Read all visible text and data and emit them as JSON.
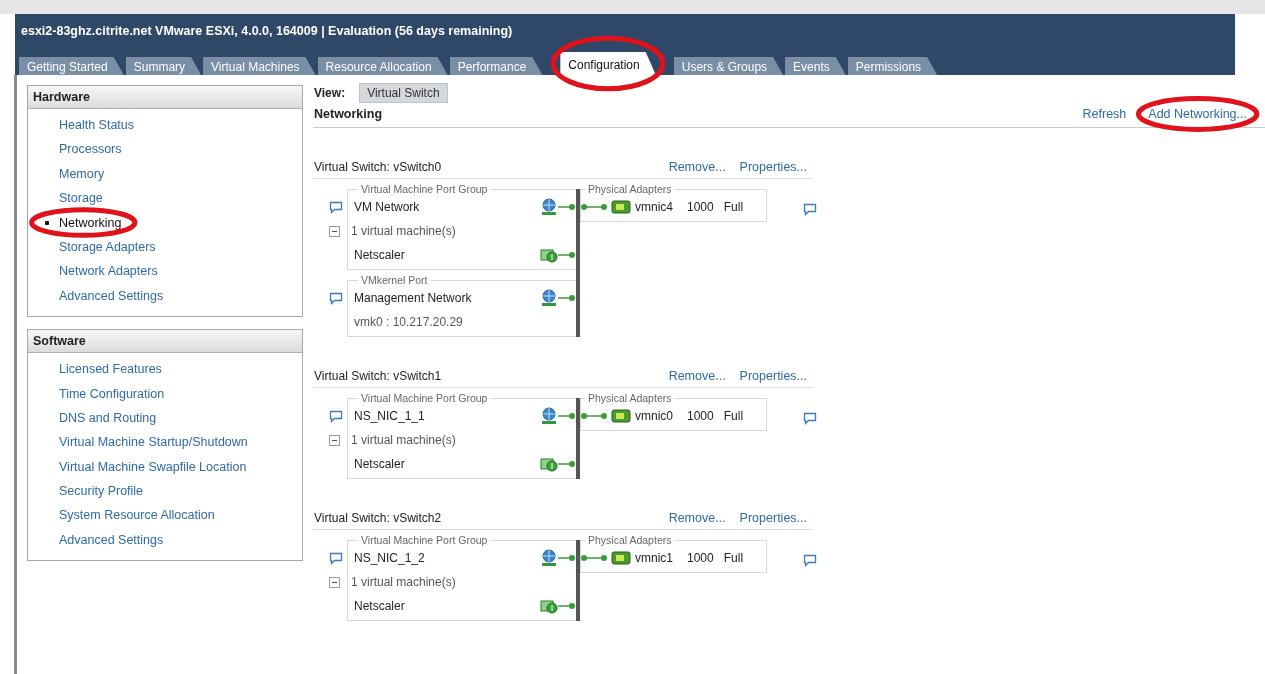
{
  "window": {
    "title": "esxi2-83ghz.citrite.net VMware ESXi, 4.0.0, 164009 | Evaluation (56 days remaining)"
  },
  "tabs": [
    {
      "label": "Getting Started",
      "selected": false,
      "circled": false
    },
    {
      "label": "Summary",
      "selected": false,
      "circled": false
    },
    {
      "label": "Virtual Machines",
      "selected": false,
      "circled": false
    },
    {
      "label": "Resource Allocation",
      "selected": false,
      "circled": false
    },
    {
      "label": "Performance",
      "selected": false,
      "circled": false
    },
    {
      "label": "Configuration",
      "selected": true,
      "circled": true
    },
    {
      "label": "Users & Groups",
      "selected": false,
      "circled": false
    },
    {
      "label": "Events",
      "selected": false,
      "circled": false
    },
    {
      "label": "Permissions",
      "selected": false,
      "circled": false
    }
  ],
  "sidebar": {
    "sections": [
      {
        "title": "Hardware",
        "items": [
          {
            "label": "Health Status",
            "selected": false,
            "circled": false
          },
          {
            "label": "Processors",
            "selected": false,
            "circled": false
          },
          {
            "label": "Memory",
            "selected": false,
            "circled": false
          },
          {
            "label": "Storage",
            "selected": false,
            "circled": false
          },
          {
            "label": "Networking",
            "selected": true,
            "circled": true
          },
          {
            "label": "Storage Adapters",
            "selected": false,
            "circled": false
          },
          {
            "label": "Network Adapters",
            "selected": false,
            "circled": false
          },
          {
            "label": "Advanced Settings",
            "selected": false,
            "circled": false
          }
        ]
      },
      {
        "title": "Software",
        "items": [
          {
            "label": "Licensed Features",
            "selected": false,
            "circled": false
          },
          {
            "label": "Time Configuration",
            "selected": false,
            "circled": false
          },
          {
            "label": "DNS and Routing",
            "selected": false,
            "circled": false
          },
          {
            "label": "Virtual Machine Startup/Shutdown",
            "selected": false,
            "circled": false
          },
          {
            "label": "Virtual Machine Swapfile Location",
            "selected": false,
            "circled": false
          },
          {
            "label": "Security Profile",
            "selected": false,
            "circled": false
          },
          {
            "label": "System Resource Allocation",
            "selected": false,
            "circled": false
          },
          {
            "label": "Advanced Settings",
            "selected": false,
            "circled": false
          }
        ]
      }
    ]
  },
  "main": {
    "view_label": "View:",
    "view_button": "Virtual Switch",
    "heading": "Networking",
    "actions": [
      {
        "label": "Refresh",
        "circled": false
      },
      {
        "label": "Add Networking...",
        "circled": true
      }
    ],
    "switches": [
      {
        "title": "Virtual Switch: vSwitch0",
        "actions": [
          "Remove...",
          "Properties..."
        ],
        "port_groups": [
          {
            "kind": "vm",
            "legend": "Virtual Machine Port Group",
            "name": "VM Network",
            "vm_count": "1 virtual machine(s)",
            "expanded": true,
            "vms": [
              "Netscaler"
            ]
          },
          {
            "kind": "vmkernel",
            "legend": "VMkernel Port",
            "name": "Management Network",
            "address": "vmk0 : 10.217.20.29"
          }
        ],
        "adapters_legend": "Physical Adapters",
        "adapters": [
          {
            "name": "vmnic4",
            "speed": "1000",
            "duplex": "Full"
          }
        ]
      },
      {
        "title": "Virtual Switch: vSwitch1",
        "actions": [
          "Remove...",
          "Properties..."
        ],
        "port_groups": [
          {
            "kind": "vm",
            "legend": "Virtual Machine Port Group",
            "name": "NS_NIC_1_1",
            "vm_count": "1 virtual machine(s)",
            "expanded": true,
            "vms": [
              "Netscaler"
            ]
          }
        ],
        "adapters_legend": "Physical Adapters",
        "adapters": [
          {
            "name": "vmnic0",
            "speed": "1000",
            "duplex": "Full"
          }
        ]
      },
      {
        "title": "Virtual Switch: vSwitch2",
        "actions": [
          "Remove...",
          "Properties..."
        ],
        "port_groups": [
          {
            "kind": "vm",
            "legend": "Virtual Machine Port Group",
            "name": "NS_NIC_1_2",
            "vm_count": "1 virtual machine(s)",
            "expanded": true,
            "vms": [
              "Netscaler"
            ]
          }
        ],
        "adapters_legend": "Physical Adapters",
        "adapters": [
          {
            "name": "vmnic1",
            "speed": "1000",
            "duplex": "Full"
          }
        ]
      }
    ]
  }
}
